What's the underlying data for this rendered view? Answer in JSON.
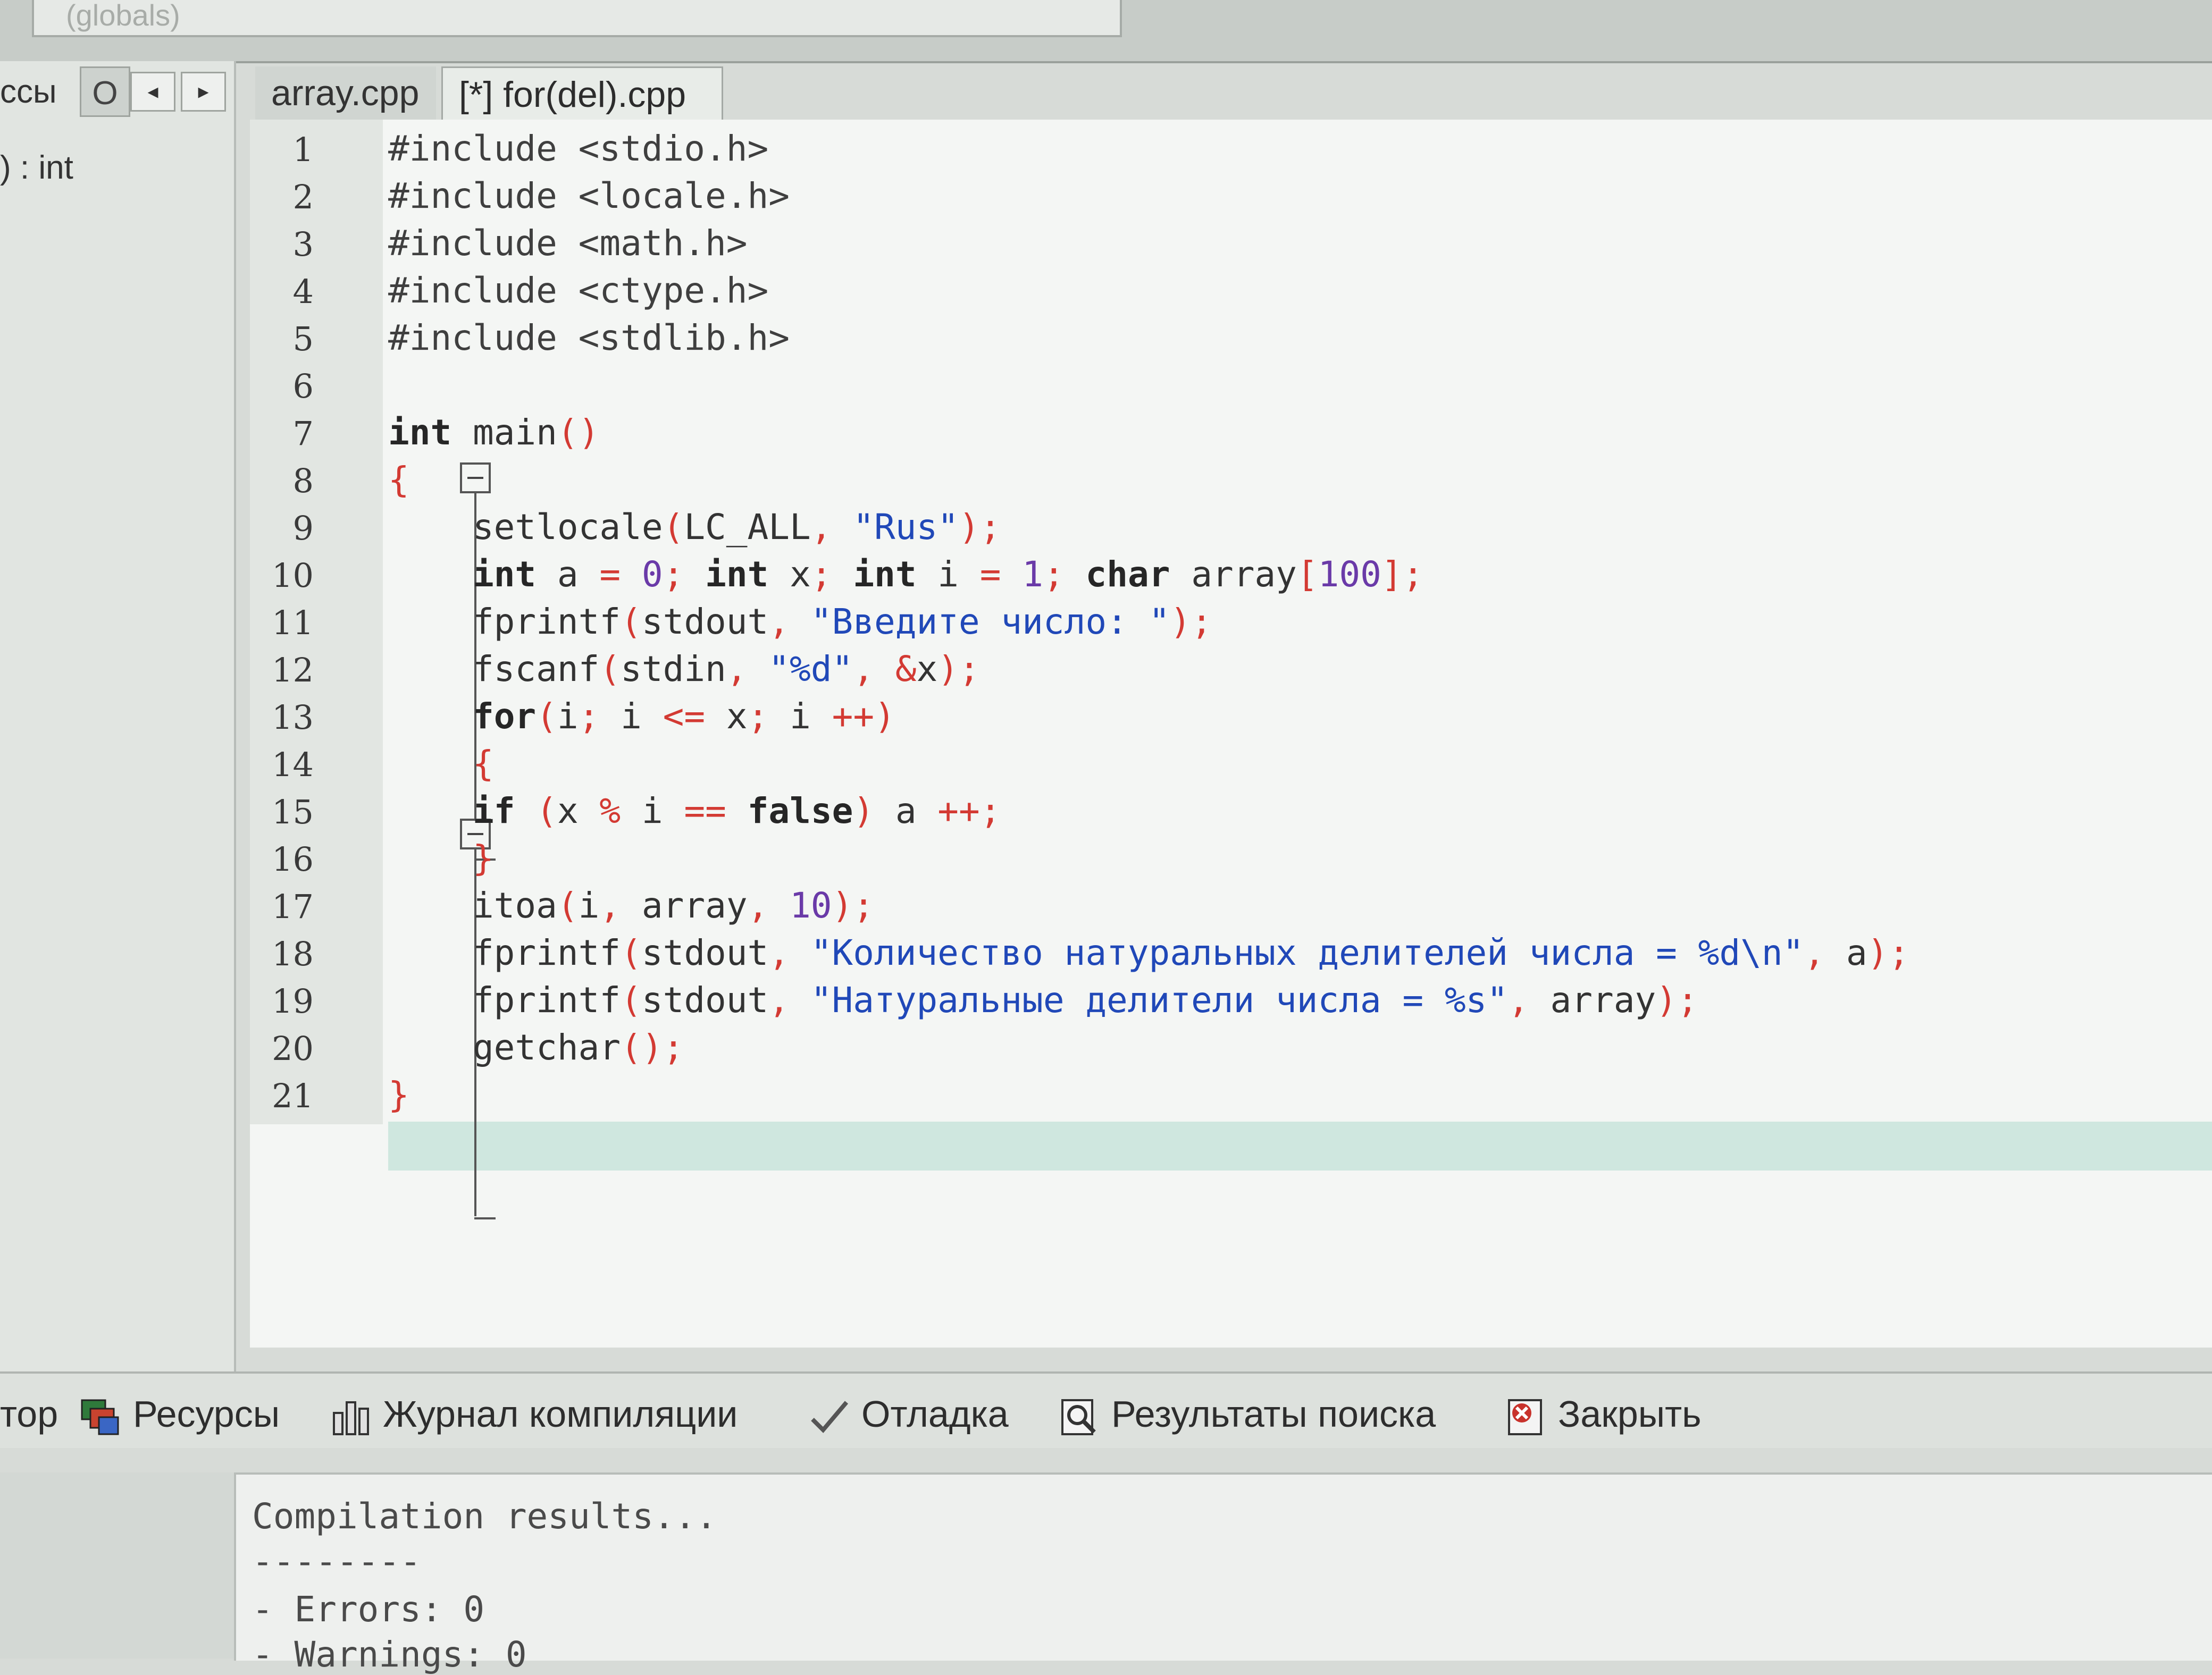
{
  "scope_combo": "(globals)",
  "left_panel": {
    "tab_classes": "ссы",
    "tab_o": "О",
    "item": ") : int"
  },
  "tabs": [
    {
      "label": "array.cpp"
    },
    {
      "label": "[*] for(del).cpp"
    }
  ],
  "editor": {
    "line_numbers": [
      "1",
      "2",
      "3",
      "4",
      "5",
      "6",
      "7",
      "8",
      "9",
      "10",
      "11",
      "12",
      "13",
      "14",
      "15",
      "16",
      "17",
      "18",
      "19",
      "20",
      "21"
    ],
    "lines": [
      "#include <stdio.h>",
      "#include <locale.h>",
      "#include <math.h>",
      "#include <ctype.h>",
      "#include <stdlib.h>",
      "",
      "int main()",
      "{",
      "    setlocale(LC_ALL, \"Rus\");",
      "    int a = 0; int x; int i = 1; char array[100];",
      "    fprintf(stdout, \"Введите число: \");",
      "    fscanf(stdin, \"%d\", &x);",
      "    for(i; i <= x; i ++)",
      "    {",
      "    if (x % i == false) a ++;",
      "    }",
      "    itoa(i, array, 10);",
      "    fprintf(stdout, \"Количество натуральных делителей числа = %d\\n\", a);",
      "    fprintf(stdout, \"Натуральные делители числа = %s\", array);",
      "    getchar();",
      "}"
    ],
    "current_line": 20
  },
  "bottom_tabs": [
    {
      "label": "тор",
      "icon": "editor-icon"
    },
    {
      "label": "Ресурсы",
      "icon": "resources-icon"
    },
    {
      "label": "Журнал компиляции",
      "icon": "compile-log-icon"
    },
    {
      "label": "Отладка",
      "icon": "debug-check-icon"
    },
    {
      "label": "Результаты поиска",
      "icon": "search-results-icon"
    },
    {
      "label": "Закрыть",
      "icon": "close-icon"
    }
  ],
  "output": {
    "lines": [
      "Compilation results...",
      "--------",
      "- Errors: 0",
      "- Warnings: 0"
    ]
  }
}
